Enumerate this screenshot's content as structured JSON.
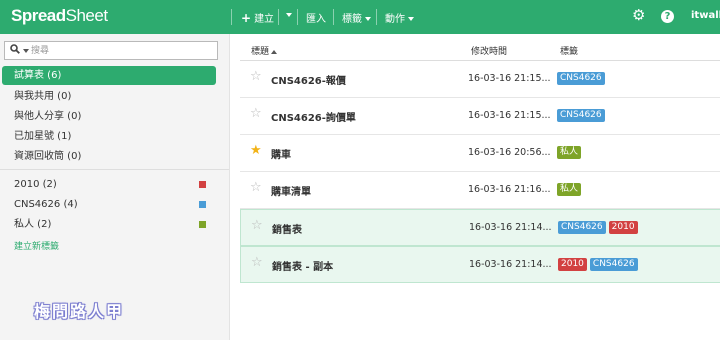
{
  "app": {
    "logo_bold": "Spread",
    "logo_rest": "Sheet"
  },
  "toolbar": {
    "create": "建立",
    "import": "匯入",
    "tags": "標籤",
    "actions": "動作",
    "settings_icon": "gear-icon",
    "help_icon": "help-icon",
    "user": "itwalke"
  },
  "sidebar": {
    "search_placeholder": "搜尋",
    "nav": [
      {
        "label": "試算表 (6)",
        "active": true
      },
      {
        "label": "與我共用 (0)"
      },
      {
        "label": "與他人分享 (0)"
      },
      {
        "label": "已加星號 (1)"
      },
      {
        "label": "資源回收筒 (0)"
      }
    ],
    "labels": [
      {
        "label": "2010 (2)",
        "color": "#d24141"
      },
      {
        "label": "CNS4626 (4)",
        "color": "#4a9cd6"
      },
      {
        "label": "私人 (2)",
        "color": "#7ea428"
      }
    ],
    "new_label": "建立新標籤",
    "watermark": "梅問路人甲"
  },
  "list": {
    "headers": {
      "title": "標題",
      "modified": "修改時間",
      "tags": "標籤"
    },
    "tag_colors": {
      "CNS4626": "#4a9cd6",
      "2010": "#d24141",
      "私人": "#7ea428"
    },
    "rows": [
      {
        "title": "CNS4626-報價",
        "time": "16-03-16 21:15...",
        "starred": false,
        "tags": [
          "CNS4626"
        ]
      },
      {
        "title": "CNS4626-詢價單",
        "time": "16-03-16 21:15...",
        "starred": false,
        "tags": [
          "CNS4626"
        ]
      },
      {
        "title": "購車",
        "time": "16-03-16 20:56...",
        "starred": true,
        "tags": [
          "私人"
        ]
      },
      {
        "title": "購車清單",
        "time": "16-03-16 21:16...",
        "starred": false,
        "tags": [
          "私人"
        ]
      },
      {
        "title": "銷售表",
        "time": "16-03-16 21:14...",
        "starred": false,
        "selected": true,
        "tags": [
          "CNS4626",
          "2010"
        ]
      },
      {
        "title": "銷售表 - 副本",
        "time": "16-03-16 21:14...",
        "starred": false,
        "selected": true,
        "tags": [
          "2010",
          "CNS4626"
        ]
      }
    ]
  }
}
